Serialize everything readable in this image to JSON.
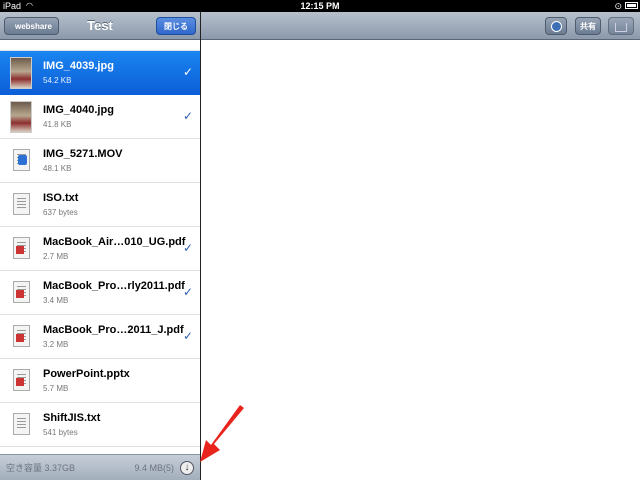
{
  "status_bar": {
    "carrier": "iPad",
    "time": "12:15 PM"
  },
  "left_nav": {
    "back_label": "webshare",
    "title": "Test",
    "close_label": "閉じる"
  },
  "files": [
    {
      "name": "",
      "size": "",
      "kind": "photo",
      "checked": false,
      "partial": true
    },
    {
      "name": "IMG_4039.jpg",
      "size": "54.2 KB",
      "kind": "photo",
      "checked": true,
      "selected": true
    },
    {
      "name": "IMG_4040.jpg",
      "size": "41.8 KB",
      "kind": "photo",
      "checked": true
    },
    {
      "name": "IMG_5271.MOV",
      "size": "48.1 KB",
      "kind": "mov",
      "checked": false
    },
    {
      "name": "ISO.txt",
      "size": "637 bytes",
      "kind": "txt",
      "checked": false
    },
    {
      "name": "MacBook_Air…010_UG.pdf",
      "size": "2.7 MB",
      "kind": "pdf",
      "checked": true
    },
    {
      "name": "MacBook_Pro…rly2011.pdf",
      "size": "3.4 MB",
      "kind": "pdf",
      "checked": true
    },
    {
      "name": "MacBook_Pro…2011_J.pdf",
      "size": "3.2 MB",
      "kind": "pdf",
      "checked": true
    },
    {
      "name": "PowerPoint.pptx",
      "size": "5.7 MB",
      "kind": "ppt",
      "checked": false
    },
    {
      "name": "ShiftJIS.txt",
      "size": "541 bytes",
      "kind": "txt",
      "checked": false
    }
  ],
  "bottom_bar": {
    "capacity": "空き容量 3.37GB",
    "used": "9.4 MB(5)"
  },
  "right_toolbar": {
    "globe_icon": "globe-icon",
    "share_label": "共有",
    "action_icon": "action-icon"
  },
  "annotation": {
    "color": "#e8241c"
  }
}
